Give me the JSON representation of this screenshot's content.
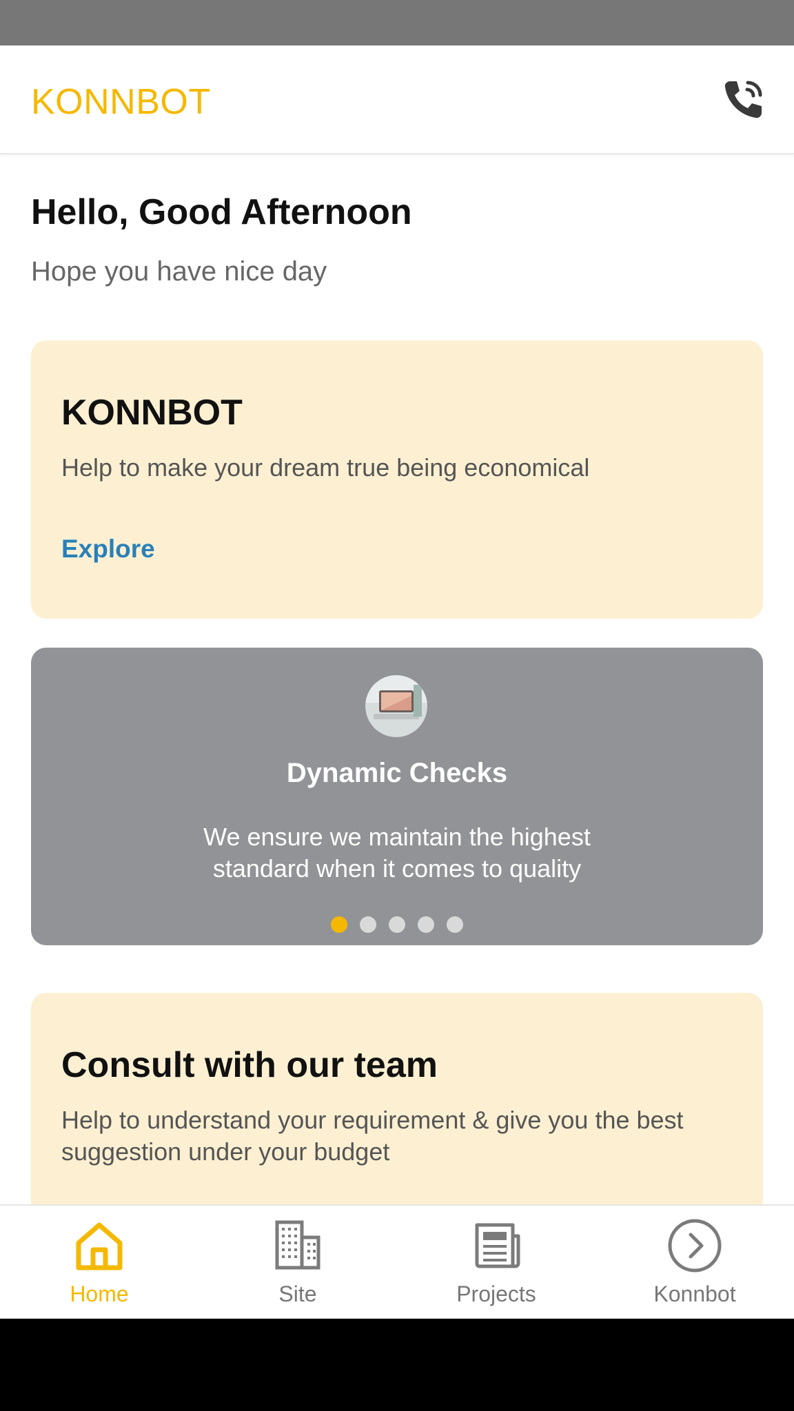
{
  "header": {
    "title": "KONNBOT",
    "call_icon": "phone-call-icon"
  },
  "greeting": {
    "title": "Hello, Good Afternoon",
    "subtitle": "Hope you have nice day"
  },
  "promo": {
    "title": "KONNBOT",
    "description": "Help to make your dream true being economical",
    "link_label": "Explore"
  },
  "carousel": {
    "title": "Dynamic Checks",
    "description": "We ensure we maintain the highest standard when it comes to quality",
    "slide_count": 5,
    "active_index": 0,
    "image": "laptop-thumbnail"
  },
  "consult": {
    "title": "Consult with our team",
    "description": "Help to understand your requirement & give you the best suggestion under your budget"
  },
  "bottom_nav": {
    "items": [
      {
        "label": "Home",
        "icon": "home-icon",
        "active": true
      },
      {
        "label": "Site",
        "icon": "building-icon",
        "active": false
      },
      {
        "label": "Projects",
        "icon": "newspaper-icon",
        "active": false
      },
      {
        "label": "Konnbot",
        "icon": "chevron-right-circle-icon",
        "active": false
      }
    ]
  },
  "colors": {
    "accent": "#F5B800",
    "link": "#2880B9",
    "card_bg": "#FDF0D2",
    "carousel_bg": "#929396"
  }
}
